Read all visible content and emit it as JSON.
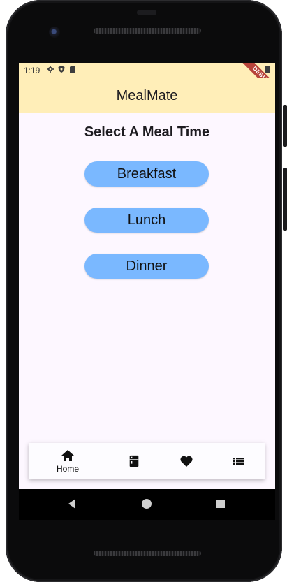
{
  "statusbar": {
    "time": "1:19"
  },
  "debug_banner": "DEBUG",
  "appbar": {
    "title": "MealMate"
  },
  "content": {
    "heading": "Select A Meal Time",
    "meals": [
      "Breakfast",
      "Lunch",
      "Dinner"
    ]
  },
  "bottom_nav": {
    "items": [
      {
        "label": "Home",
        "icon": "home-icon"
      },
      {
        "label": "",
        "icon": "fridge-icon"
      },
      {
        "label": "",
        "icon": "heart-icon"
      },
      {
        "label": "",
        "icon": "list-icon"
      }
    ]
  },
  "colors": {
    "appbar_bg": "#ffeeb8",
    "screen_bg": "#fdf7ff",
    "button_bg": "#7ab8ff",
    "debug_banner": "#b8433a"
  }
}
